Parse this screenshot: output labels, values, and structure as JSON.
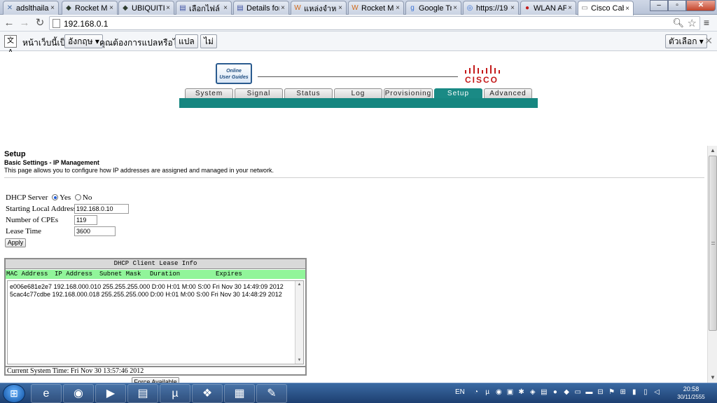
{
  "browser": {
    "tabs": [
      {
        "title": "adslthaila",
        "icon": "x-logo-icon",
        "color": "#4a6fa5"
      },
      {
        "title": "Rocket M",
        "icon": "ubiquiti-icon",
        "color": "#2f3d2f"
      },
      {
        "title": "UBIQUITI",
        "icon": "ubiquiti-icon",
        "color": "#2f3d2f"
      },
      {
        "title": "เลือกไฟล์",
        "icon": "thai-flag-icon",
        "color": "#3a4ea1"
      },
      {
        "title": "Details for",
        "icon": "thai-flag-icon",
        "color": "#3a4ea1"
      },
      {
        "title": "แหล่งจำหน่",
        "icon": "w-logo-icon",
        "color": "#d06a1a"
      },
      {
        "title": "Rocket M",
        "icon": "w-logo-icon",
        "color": "#d06a1a"
      },
      {
        "title": "Google Tr",
        "icon": "google-icon",
        "color": "#3b73d6"
      },
      {
        "title": "https://19",
        "icon": "feed-icon",
        "color": "#3b73d6"
      },
      {
        "title": "WLAN AP",
        "icon": "eye-icon",
        "color": "#c41a1a"
      },
      {
        "title": "Cisco Cab",
        "icon": "page-icon",
        "color": "#777777"
      }
    ],
    "url": "192.168.0.1"
  },
  "translate": {
    "msg1": "หน้าเว็บนี้เป็น",
    "language": "อังกฤษ",
    "msg2": "คุณต้องการแปลหรือไม่",
    "translate_btn": "แปล",
    "no_btn": "ไม่",
    "options_btn": "ตัวเลือก"
  },
  "header": {
    "guide_line1": "Online",
    "guide_line2": "User Guides",
    "brand": "CISCO",
    "brand_color": "#c41a1a",
    "teal": "#168680",
    "tabs": [
      {
        "label": "System",
        "active": false
      },
      {
        "label": "Signal",
        "active": false
      },
      {
        "label": "Status",
        "active": false
      },
      {
        "label": "Log",
        "active": false
      },
      {
        "label": "Provisioning",
        "active": false
      },
      {
        "label": "Setup",
        "active": true
      },
      {
        "label": "Advanced",
        "active": false
      }
    ]
  },
  "setup": {
    "title": "Setup",
    "subtitle": "Basic Settings - IP Management",
    "description": "This page allows you to configure how IP addresses are assigned and managed in your network.",
    "dhcp_server_label": "DHCP Server",
    "yes_label": "Yes",
    "no_label": "No",
    "dhcp_enabled": "Yes",
    "starting_address_label": "Starting Local Address",
    "starting_address": "192.168.0.10",
    "cpes_label": "Number of CPEs",
    "cpes": "119",
    "lease_label": "Lease Time",
    "lease": "3600",
    "apply": "Apply"
  },
  "dhcp_table": {
    "title": "DHCP Client Lease Info",
    "columns": [
      "MAC Address",
      "IP Address",
      "Subnet Mask",
      "Duration",
      "Expires"
    ],
    "rows": [
      "e006e681e2e7  192.168.000.010  255.255.255.000  D:00 H:01 M:00 S:00  Fri Nov 30 14:49:09 2012",
      "5cac4c77cdbe  192.168.000.018  255.255.255.000  D:00 H:01 M:00 S:00  Fri Nov 30 14:48:29 2012"
    ],
    "current_time": "Current System Time: Fri Nov 30 13:57:46 2012",
    "force_available": "Force Available"
  },
  "taskbar": {
    "lang": "EN",
    "time": "20:58",
    "date": "30/11/2555"
  }
}
